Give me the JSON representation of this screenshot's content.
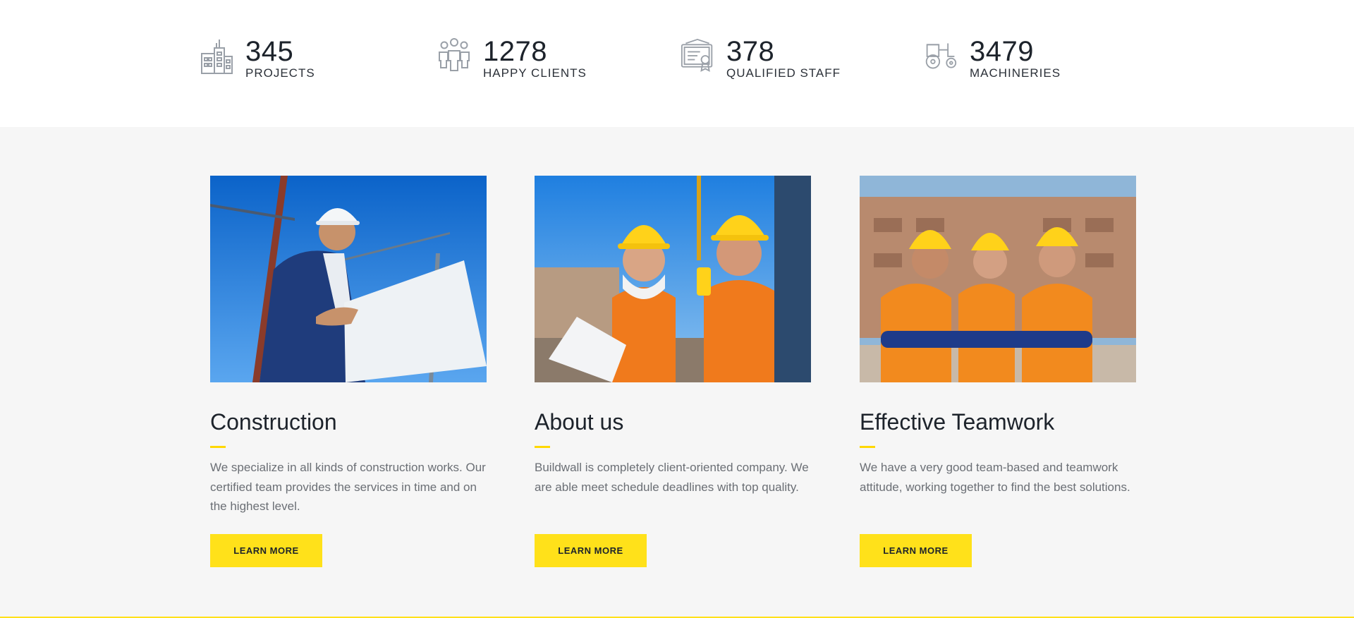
{
  "stats": [
    {
      "icon": "buildings-icon",
      "number": "345",
      "label": "PROJECTS"
    },
    {
      "icon": "people-group-icon",
      "number": "1278",
      "label": "HAPPY CLIENTS"
    },
    {
      "icon": "certificate-icon",
      "number": "378",
      "label": "QUALIFIED STAFF"
    },
    {
      "icon": "tractor-icon",
      "number": "3479",
      "label": "MACHINERIES"
    }
  ],
  "cards": [
    {
      "image": "engineer-with-blueprint-photo",
      "title": "Construction",
      "text": "We specialize in all kinds of construction works. Our certified team provides the services in time and on the highest level.",
      "button": "LEARN MORE"
    },
    {
      "image": "workers-in-hardhats-photo",
      "title": "About us",
      "text": "Buildwall is completely client-oriented company. We are able meet schedule deadlines with top quality.",
      "button": "LEARN MORE"
    },
    {
      "image": "team-of-builders-photo",
      "title": "Effective Teamwork",
      "text": "We have a very good team-based and teamwork attitude, working together to find the best solutions.",
      "button": "LEARN MORE"
    }
  ],
  "colors": {
    "accent": "#ffe11a",
    "heading": "#1d232b",
    "body_text": "#6b6f75",
    "section_bg": "#f6f6f6",
    "icon_gray": "#9aa0a8"
  }
}
